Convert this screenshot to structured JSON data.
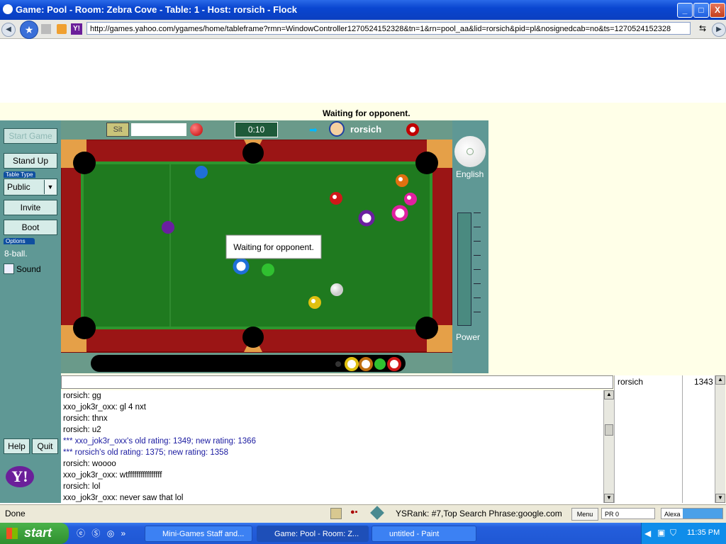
{
  "window": {
    "title": "Game: Pool - Room: Zebra Cove - Table: 1 - Host: rorsich - Flock",
    "minimize": "_",
    "maximize": "□",
    "close": "X"
  },
  "browser": {
    "url": "http://games.yahoo.com/ygames/home/tableframe?rmn=WindowController1270524152328&tn=1&rn=pool_aa&lid=rorsich&pid=pl&nosignedcab=no&ts=1270524152328"
  },
  "game": {
    "status_top": "Waiting for opponent.",
    "timer": "0:10",
    "my_label": "Sit",
    "host_name": "rorsich",
    "table_message": "Waiting for opponent.",
    "english_label": "English",
    "power_label": "Power"
  },
  "left_panel": {
    "start_game": "Start Game",
    "stand_up": "Stand Up",
    "table_type_label": "Table Type",
    "table_type_value": "Public",
    "invite": "Invite",
    "boot": "Boot",
    "options_label": "Options",
    "game_type": "8-ball.",
    "sound": "Sound",
    "help": "Help",
    "quit": "Quit",
    "logo": "Y!"
  },
  "chat": {
    "messages": [
      {
        "text": "rorsich: gg",
        "system": false
      },
      {
        "text": "xxo_jok3r_oxx: gl 4 nxt",
        "system": false
      },
      {
        "text": "rorsich: thnx",
        "system": false
      },
      {
        "text": "rorsich: u2",
        "system": false
      },
      {
        "text": "*** xxo_jok3r_oxx's old rating: 1349; new rating: 1366",
        "system": true
      },
      {
        "text": "*** rorsich's old rating: 1375; new rating: 1358",
        "system": true
      },
      {
        "text": "rorsich: woooo",
        "system": false
      },
      {
        "text": "xxo_jok3r_oxx: wtffffffffffffffff",
        "system": false
      },
      {
        "text": "rorsich: lol",
        "system": false
      },
      {
        "text": "xxo_jok3r_oxx: never saw that lol",
        "system": false
      }
    ]
  },
  "users": [
    {
      "name": "rorsich",
      "rating": "1343"
    }
  ],
  "statusbar": {
    "status": "Done",
    "ysrank": "YSRank: #7,Top Search Phrase:google.com",
    "menu": "Menu",
    "pr": "PR 0",
    "alexa": "Alexa"
  },
  "taskbar": {
    "start": "start",
    "tasks": [
      "Mini-Games Staff and...",
      "Game: Pool - Room: Z...",
      "untitled - Paint"
    ],
    "clock": "11:35 PM"
  },
  "colors": {
    "felt": "#1f7a1f",
    "rail": "#9b1515",
    "panel": "#5f9895"
  }
}
